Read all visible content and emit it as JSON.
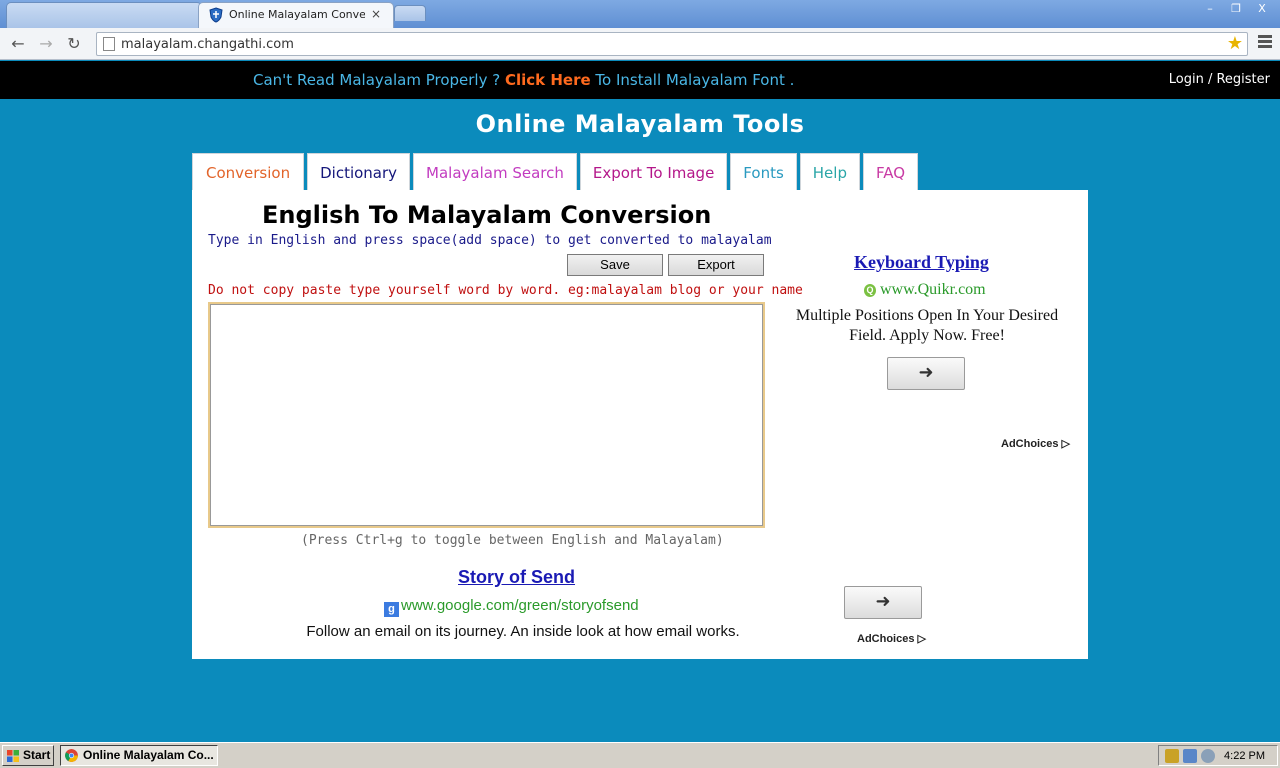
{
  "browser": {
    "tab_title": "Online Malayalam Converter",
    "tab_close": "×",
    "url": "malayalam.changathi.com",
    "window_controls": [
      "–",
      "❐",
      "X"
    ]
  },
  "topbar": {
    "notice_pre": "Can't Read Malayalam Properly ? ",
    "notice_link": "Click Here",
    "notice_post": " To Install Malayalam Font .",
    "login": "Login / Register"
  },
  "site": {
    "title": "Online Malayalam Tools"
  },
  "nav": {
    "tabs": [
      {
        "label": "Conversion",
        "color": "#e2642a"
      },
      {
        "label": "Dictionary",
        "color": "#14167a"
      },
      {
        "label": "Malayalam Search",
        "color": "#c23cc0"
      },
      {
        "label": "Export To Image",
        "color": "#b4178a"
      },
      {
        "label": "Fonts",
        "color": "#2a9ac0"
      },
      {
        "label": "Help",
        "color": "#2aa6a8"
      },
      {
        "label": "FAQ",
        "color": "#c83aa4"
      }
    ]
  },
  "converter": {
    "title": "English To Malayalam Conversion",
    "subtitle": "Type in English and press space(add space) to get converted to malayalam",
    "save_label": "Save",
    "export_label": "Export",
    "warning": "Do not copy paste type yourself word by word. eg:malayalam blog or your name",
    "text_value": "",
    "hint": "(Press Ctrl+g to toggle between English and Malayalam)"
  },
  "ad_right": {
    "title": "Keyboard Typing",
    "url": "www.Quikr.com",
    "text": "Multiple Positions Open In Your Desired Field. Apply Now. Free!",
    "adchoices": "AdChoices"
  },
  "ad_bottom": {
    "title": "Story of Send",
    "url": "www.google.com/green/storyofsend",
    "text": "Follow an email on its journey. An inside look at how email works.",
    "adchoices": "AdChoices"
  },
  "taskbar": {
    "start_label": "Start",
    "task_label": "Online Malayalam Co...",
    "clock": "4:22 PM"
  }
}
